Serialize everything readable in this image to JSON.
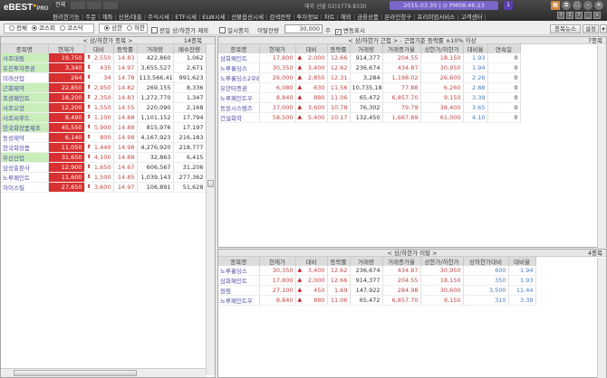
{
  "app": {
    "logo": "eBEST",
    "logo_sub": "PRO",
    "tabs": [
      "전체",
      "",
      "",
      ""
    ],
    "phone": "해외 선물 02)3779-8330",
    "clock": "2015.03.30 | ⊙ PM08:46:23",
    "menu": [
      "편리한기능",
      "주문",
      "계좌",
      "신용/대출",
      "주식시세",
      "ETF시세",
      "ELW시세",
      "선물옵션시세",
      "검색전략",
      "투자정보",
      "차트",
      "해외",
      "금융상품",
      "온라인창구",
      "프리미엄서비스",
      "고객센터"
    ]
  },
  "toolbar": {
    "market_options": [
      "전체",
      "코스피",
      "코스닥"
    ],
    "market_selected": "코스피",
    "limit_options": [
      "상한",
      "하한"
    ],
    "limit_selected": "상한",
    "exclude_prev_label": "전일 상/하한가 제외",
    "pause_label": "일시중지",
    "gap_label": "이탈잔량",
    "gap_value": "30,000",
    "unit": "주",
    "show_change_label": "변동표시",
    "news_button": "종목뉴스",
    "settings_button": "설정"
  },
  "colors": {
    "price_bg": "#d83030",
    "name_highlight": "#c9eeb9",
    "up": "#c04848",
    "ratio": "#4a7cc0"
  },
  "left": {
    "title": "< 상/하한가 종목 >",
    "count": "14종목",
    "columns": [
      "종목명",
      "현재가",
      "대비",
      "등락률",
      "거래량",
      "매수잔량"
    ],
    "rows": [
      {
        "name": "사조대림",
        "price": "19,750",
        "change": "2,550",
        "rate": "14.83",
        "volume": "422,860",
        "bid": "1,062",
        "hl": true
      },
      {
        "name": "유진투자증권",
        "price": "3,340",
        "change": "435",
        "rate": "14.97",
        "volume": "3,655,527",
        "bid": "2,671",
        "hl": true
      },
      {
        "name": "미래산업",
        "price": "264",
        "change": "34",
        "rate": "14.78",
        "volume": "113,566,415",
        "bid": "991,623",
        "hl": false
      },
      {
        "name": "근화제약",
        "price": "22,850",
        "change": "2,950",
        "rate": "14.82",
        "volume": "269,155",
        "bid": "8,336",
        "hl": true
      },
      {
        "name": "조광페인트",
        "price": "18,200",
        "change": "2,350",
        "rate": "14.83",
        "volume": "1,272,770",
        "bid": "1,347",
        "hl": true
      },
      {
        "name": "사조오양",
        "price": "12,200",
        "change": "1,550",
        "rate": "14.55",
        "volume": "220,090",
        "bid": "2,168",
        "hl": true
      },
      {
        "name": "사조씨푸드",
        "price": "8,490",
        "change": "1,100",
        "rate": "14.88",
        "volume": "1,101,152",
        "bid": "17,794",
        "hl": true
      },
      {
        "name": "한국화장품제조",
        "price": "45,550",
        "change": "5,900",
        "rate": "14.88",
        "volume": "815,976",
        "bid": "17,197",
        "hl": true
      },
      {
        "name": "동성제약",
        "price": "6,140",
        "change": "800",
        "rate": "14.98",
        "volume": "4,167,923",
        "bid": "216,183",
        "hl": false
      },
      {
        "name": "한국화장품",
        "price": "11,050",
        "change": "1,440",
        "rate": "14.98",
        "volume": "4,276,920",
        "bid": "218,777",
        "hl": false
      },
      {
        "name": "부산산업",
        "price": "31,650",
        "change": "4,100",
        "rate": "14.88",
        "volume": "32,863",
        "bid": "6,415",
        "hl": true
      },
      {
        "name": "삼성출판사",
        "price": "12,900",
        "change": "1,650",
        "rate": "14.67",
        "volume": "606,567",
        "bid": "31,206",
        "hl": false
      },
      {
        "name": "노루페인트",
        "price": "11,600",
        "change": "1,500",
        "rate": "14.85",
        "volume": "1,039,143",
        "bid": "277,362",
        "hl": false
      },
      {
        "name": "하이스틸",
        "price": "27,650",
        "change": "3,600",
        "rate": "14.97",
        "volume": "106,891",
        "bid": "51,628",
        "hl": false
      }
    ]
  },
  "near": {
    "title": "< 상/하한가 근접 > - 근접기준 등락률 ±10% 이상",
    "count": "7종목",
    "columns": [
      "종목명",
      "현재가",
      "대비",
      "등락률",
      "거래량",
      "거래증가율",
      "상한가/하한가",
      "대비율",
      "연속일"
    ],
    "rows": [
      [
        "삼화페인트",
        "17,800",
        "2,000",
        "12.66",
        "914,377",
        "204.55",
        "18,150",
        "1.93",
        "0"
      ],
      [
        "노루홀딩스",
        "30,350",
        "3,400",
        "12.62",
        "236,674",
        "434.87",
        "30,950",
        "1.94",
        "0"
      ],
      [
        "노루홀딩스2우B",
        "26,000",
        "2,850",
        "12.31",
        "3,284",
        "1,198.02",
        "26,600",
        "2.26",
        "0"
      ],
      [
        "유안타증권",
        "6,080",
        "630",
        "11.56",
        "10,735,184",
        "77.88",
        "6,260",
        "2.88",
        "0"
      ],
      [
        "노루페인트우",
        "8,840",
        "880",
        "11.06",
        "65,472",
        "6,857.70",
        "9,150",
        "3.39",
        "0"
      ],
      [
        "동원시스템즈",
        "37,000",
        "3,600",
        "10.78",
        "76,302",
        "79.79",
        "38,400",
        "3.65",
        "0"
      ],
      [
        "건설화학",
        "58,500",
        "5,400",
        "10.17",
        "132,450",
        "1,667.89",
        "61,000",
        "4.10",
        "0"
      ]
    ]
  },
  "away": {
    "title": "< 상/하한가 이탈 >",
    "count": "4종목",
    "columns": [
      "종목명",
      "현재가",
      "대비",
      "등락률",
      "거래량",
      "거래증가율",
      "상한가/하한가",
      "상하한가대비",
      "대비율"
    ],
    "rows": [
      [
        "노루홀딩스",
        "30,350",
        "3,400",
        "12.62",
        "236,674",
        "434.87",
        "30,950",
        "600",
        "1.94"
      ],
      [
        "삼화페인트",
        "17,800",
        "2,000",
        "12.66",
        "914,377",
        "204.55",
        "18,150",
        "350",
        "1.93"
      ],
      [
        "원림",
        "27,100",
        "450",
        "1.69",
        "147,922",
        "284.98",
        "30,600",
        "3,500",
        "11.44"
      ],
      [
        "노루페인트우",
        "8,840",
        "880",
        "11.06",
        "65,472",
        "6,857.70",
        "9,150",
        "310",
        "3.39"
      ]
    ]
  }
}
